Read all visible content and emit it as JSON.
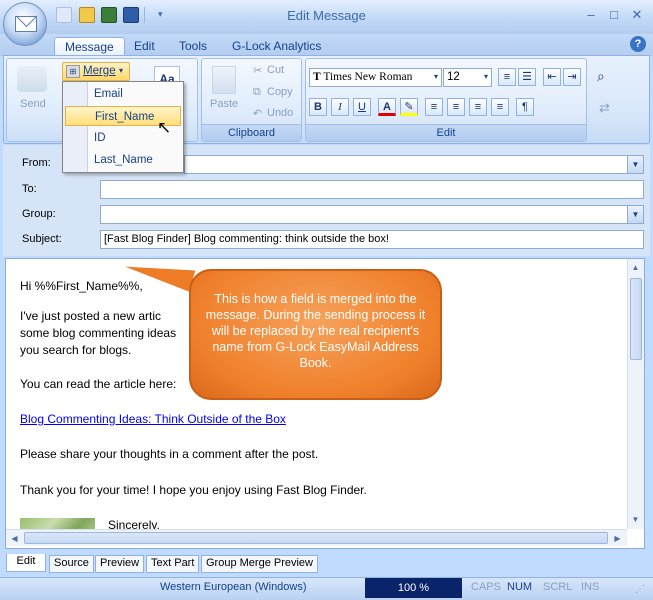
{
  "window": {
    "title": "Edit Message",
    "controls": {
      "minimize": "–",
      "maximize": "□",
      "close": "✕"
    }
  },
  "ribbon_tabs": [
    {
      "label": "Message",
      "active": true
    },
    {
      "label": "Edit"
    },
    {
      "label": "Tools"
    },
    {
      "label": "G-Lock Analytics"
    }
  ],
  "help_label": "?",
  "ribbon": {
    "send_label": "Send",
    "merge_label": "Merge",
    "merge_menu": [
      "Email",
      "First_Name",
      "ID",
      "Last_Name"
    ],
    "merge_highlighted": "First_Name",
    "paste_label": "Paste",
    "cut_label": "Cut",
    "copy_label": "Copy",
    "undo_label": "Undo",
    "clipboard_group": "Clipboard",
    "edit_group": "Edit",
    "font_name": "Times New Roman",
    "font_size": "12",
    "font_glyph": "Aa",
    "font_icon_glyph": "T",
    "bold": "B",
    "italic": "I",
    "underline": "U",
    "font_color_glyph": "A"
  },
  "fields": {
    "from_label": "From:",
    "to_label": "To:",
    "group_label": "Group:",
    "subject_label": "Subject:",
    "from_value": "",
    "to_value": "",
    "group_value": "",
    "subject_value": "[Fast Blog Finder] Blog commenting: think outside the box!"
  },
  "body": {
    "greeting": "Hi %%First_Name%%,",
    "line1": "I've just posted a new artic",
    "line2": "some blog commenting ideas",
    "line3": "you search for blogs.",
    "line4": "You can read the article here:",
    "link": "Blog Commenting Ideas: Think Outside of the Box",
    "line5": "Please share your thoughts in a comment after the post.",
    "line6": "Thank you for your time! I hope you enjoy using Fast Blog Finder.",
    "signoff": "Sincerely,"
  },
  "callout": {
    "text": "This is how a field is merged into the message. During the sending process it will be replaced by the real recipient's name from G-Lock EasyMail Address Book."
  },
  "bottom_tabs": [
    {
      "label": "Edit",
      "active": true
    },
    {
      "label": "Source"
    },
    {
      "label": "Preview"
    },
    {
      "label": "Text Part"
    },
    {
      "label": "Group Merge Preview"
    }
  ],
  "status": {
    "encoding": "Western European (Windows)",
    "zoom": "100 %",
    "caps": "CAPS",
    "num": "NUM",
    "scrl": "SCRL",
    "ins": "INS"
  },
  "colors": {
    "accent": "#15428b",
    "callout": "#ef7f2a",
    "zoom_bg": "#0a246a",
    "highlight": "#ffde7a"
  }
}
